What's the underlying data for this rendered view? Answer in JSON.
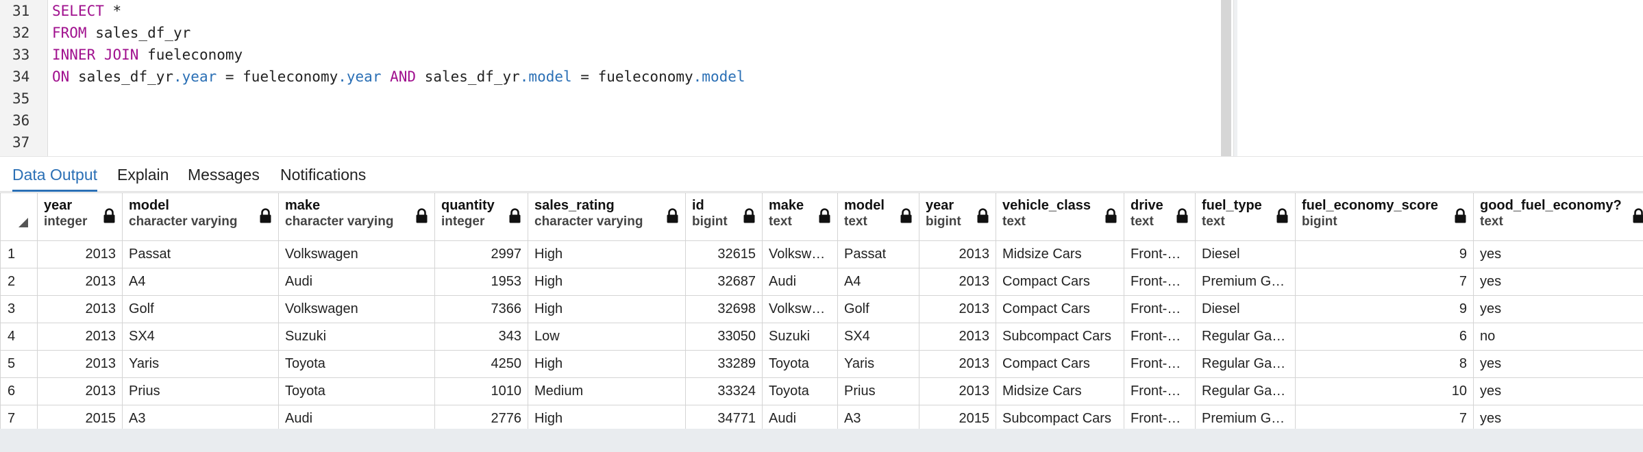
{
  "editor": {
    "lines": [
      {
        "num": "31",
        "tokens": [
          {
            "t": "SELECT",
            "c": "kw"
          },
          {
            "t": " *",
            "c": ""
          }
        ]
      },
      {
        "num": "32",
        "tokens": [
          {
            "t": "FROM",
            "c": "kw"
          },
          {
            "t": " sales_df_yr",
            "c": ""
          }
        ]
      },
      {
        "num": "33",
        "tokens": [
          {
            "t": "INNER JOIN",
            "c": "kw"
          },
          {
            "t": " fueleconomy",
            "c": ""
          }
        ]
      },
      {
        "num": "34",
        "tokens": [
          {
            "t": "ON",
            "c": "kw"
          },
          {
            "t": " sales_df_yr",
            "c": ""
          },
          {
            "t": ".year",
            "c": "prop"
          },
          {
            "t": " = fueleconomy",
            "c": ""
          },
          {
            "t": ".year",
            "c": "prop"
          },
          {
            "t": " ",
            "c": ""
          },
          {
            "t": "AND",
            "c": "kw"
          },
          {
            "t": " sales_df_yr",
            "c": ""
          },
          {
            "t": ".model",
            "c": "prop"
          },
          {
            "t": " = fueleconomy",
            "c": ""
          },
          {
            "t": ".model",
            "c": "prop"
          }
        ]
      },
      {
        "num": "35",
        "tokens": []
      },
      {
        "num": "36",
        "tokens": []
      },
      {
        "num": "37",
        "tokens": []
      }
    ]
  },
  "tabs": [
    {
      "label": "Data Output",
      "active": true
    },
    {
      "label": "Explain",
      "active": false
    },
    {
      "label": "Messages",
      "active": false
    },
    {
      "label": "Notifications",
      "active": false
    }
  ],
  "columns": [
    {
      "name": "year",
      "type": "integer",
      "align": "right"
    },
    {
      "name": "model",
      "type": "character varying",
      "align": "left"
    },
    {
      "name": "make",
      "type": "character varying",
      "align": "left"
    },
    {
      "name": "quantity",
      "type": "integer",
      "align": "right"
    },
    {
      "name": "sales_rating",
      "type": "character varying",
      "align": "left"
    },
    {
      "name": "id",
      "type": "bigint",
      "align": "right"
    },
    {
      "name": "make",
      "type": "text",
      "align": "left"
    },
    {
      "name": "model",
      "type": "text",
      "align": "left"
    },
    {
      "name": "year",
      "type": "bigint",
      "align": "right"
    },
    {
      "name": "vehicle_class",
      "type": "text",
      "align": "left"
    },
    {
      "name": "drive",
      "type": "text",
      "align": "left"
    },
    {
      "name": "fuel_type",
      "type": "text",
      "align": "left"
    },
    {
      "name": "fuel_economy_score",
      "type": "bigint",
      "align": "right"
    },
    {
      "name": "good_fuel_economy?",
      "type": "text",
      "align": "left"
    }
  ],
  "rows": [
    {
      "rownum": "1",
      "cells": [
        "2013",
        "Passat",
        "Volkswagen",
        "2997",
        "High",
        "32615",
        "Volkswa…",
        "Passat",
        "2013",
        "Midsize Cars",
        "Front-W…",
        "Diesel",
        "9",
        "yes"
      ]
    },
    {
      "rownum": "2",
      "cells": [
        "2013",
        "A4",
        "Audi",
        "1953",
        "High",
        "32687",
        "Audi",
        "A4",
        "2013",
        "Compact Cars",
        "Front-W…",
        "Premium Gas…",
        "7",
        "yes"
      ]
    },
    {
      "rownum": "3",
      "cells": [
        "2013",
        "Golf",
        "Volkswagen",
        "7366",
        "High",
        "32698",
        "Volkswa…",
        "Golf",
        "2013",
        "Compact Cars",
        "Front-W…",
        "Diesel",
        "9",
        "yes"
      ]
    },
    {
      "rownum": "4",
      "cells": [
        "2013",
        "SX4",
        "Suzuki",
        "343",
        "Low",
        "33050",
        "Suzuki",
        "SX4",
        "2013",
        "Subcompact Cars",
        "Front-W…",
        "Regular Gaso…",
        "6",
        "no"
      ]
    },
    {
      "rownum": "5",
      "cells": [
        "2013",
        "Yaris",
        "Toyota",
        "4250",
        "High",
        "33289",
        "Toyota",
        "Yaris",
        "2013",
        "Compact Cars",
        "Front-W…",
        "Regular Gaso…",
        "8",
        "yes"
      ]
    },
    {
      "rownum": "6",
      "cells": [
        "2013",
        "Prius",
        "Toyota",
        "1010",
        "Medium",
        "33324",
        "Toyota",
        "Prius",
        "2013",
        "Midsize Cars",
        "Front-W…",
        "Regular Gaso…",
        "10",
        "yes"
      ]
    },
    {
      "rownum": "7",
      "cells": [
        "2015",
        "A3",
        "Audi",
        "2776",
        "High",
        "34771",
        "Audi",
        "A3",
        "2015",
        "Subcompact Cars",
        "Front-W…",
        "Premium Gas…",
        "7",
        "yes"
      ]
    }
  ],
  "icons": {
    "lock": "lock-icon",
    "select_all": "select-all-corner-icon"
  },
  "colors": {
    "keyword": "#a0108e",
    "property": "#2a6fb5",
    "active_tab": "#2a6fb5"
  }
}
